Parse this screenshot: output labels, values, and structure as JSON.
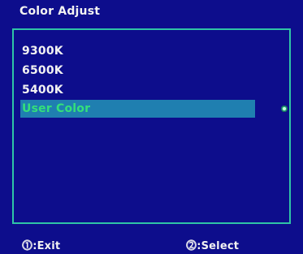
{
  "title": "Color Adjust",
  "menu": {
    "items": [
      {
        "label": "9300K",
        "selected": false
      },
      {
        "label": "6500K",
        "selected": false
      },
      {
        "label": "5400K",
        "selected": false
      },
      {
        "label": "User Color",
        "selected": true
      }
    ]
  },
  "footer": {
    "exit_label": "⓵:Exit",
    "select_label": "⓶:Select"
  },
  "colors": {
    "background": "#0d0d8c",
    "border": "#2fc4a6",
    "highlight": "#1f7fb0",
    "highlight_text": "#34e07a",
    "text": "#f2f2f2"
  }
}
